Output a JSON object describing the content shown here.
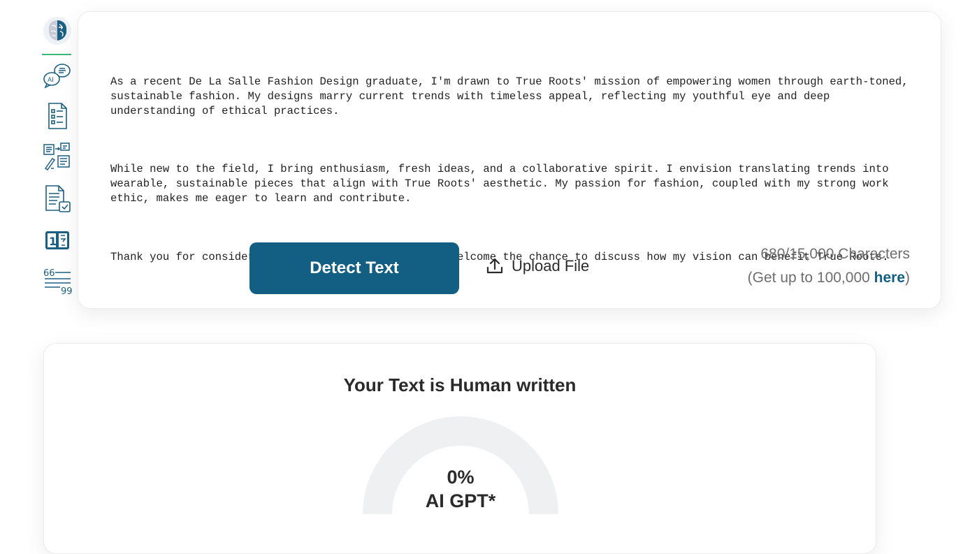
{
  "sidebar": {
    "tools": [
      {
        "icon": "brain-icon"
      },
      {
        "icon": "ai-chat-icon"
      },
      {
        "icon": "document-list-icon"
      },
      {
        "icon": "rewrite-flow-icon"
      },
      {
        "icon": "document-check-icon"
      },
      {
        "icon": "word-counter-icon"
      },
      {
        "icon": "quote-icon"
      }
    ],
    "accent": "#3cb878",
    "icon_color": "#1b5f84"
  },
  "editor": {
    "paragraphs": [
      "As a recent De La Salle Fashion Design graduate, I'm drawn to True Roots' mission of empowering women through earth-toned, sustainable fashion. My designs marry current trends with timeless appeal, reflecting my youthful eye and deep understanding of ethical practices.",
      "While new to the field, I bring enthusiasm, fresh ideas, and a collaborative spirit. I envision translating trends into wearable, sustainable pieces that align with True Roots' aesthetic. My passion for fashion, coupled with my strong work ethic, makes me eager to learn and contribute.",
      "Thank you for considering my application, Helena. I welcome the chance to discuss how my vision can benefit True Roots."
    ],
    "detect_button": "Detect Text",
    "upload_label": "Upload File",
    "upload_icon": "upload-icon",
    "char_count": "680/15,000 Characters",
    "upgrade_prefix": "(Get up to 100,000 ",
    "upgrade_link": "here",
    "upgrade_suffix": ")",
    "brand_color": "#135e83"
  },
  "result": {
    "title": "Your Text is Human written",
    "percent_label": "0%",
    "metric_label": "AI GPT*",
    "ai_fraction": 0,
    "gauge_track_color": "#eff0f2"
  }
}
